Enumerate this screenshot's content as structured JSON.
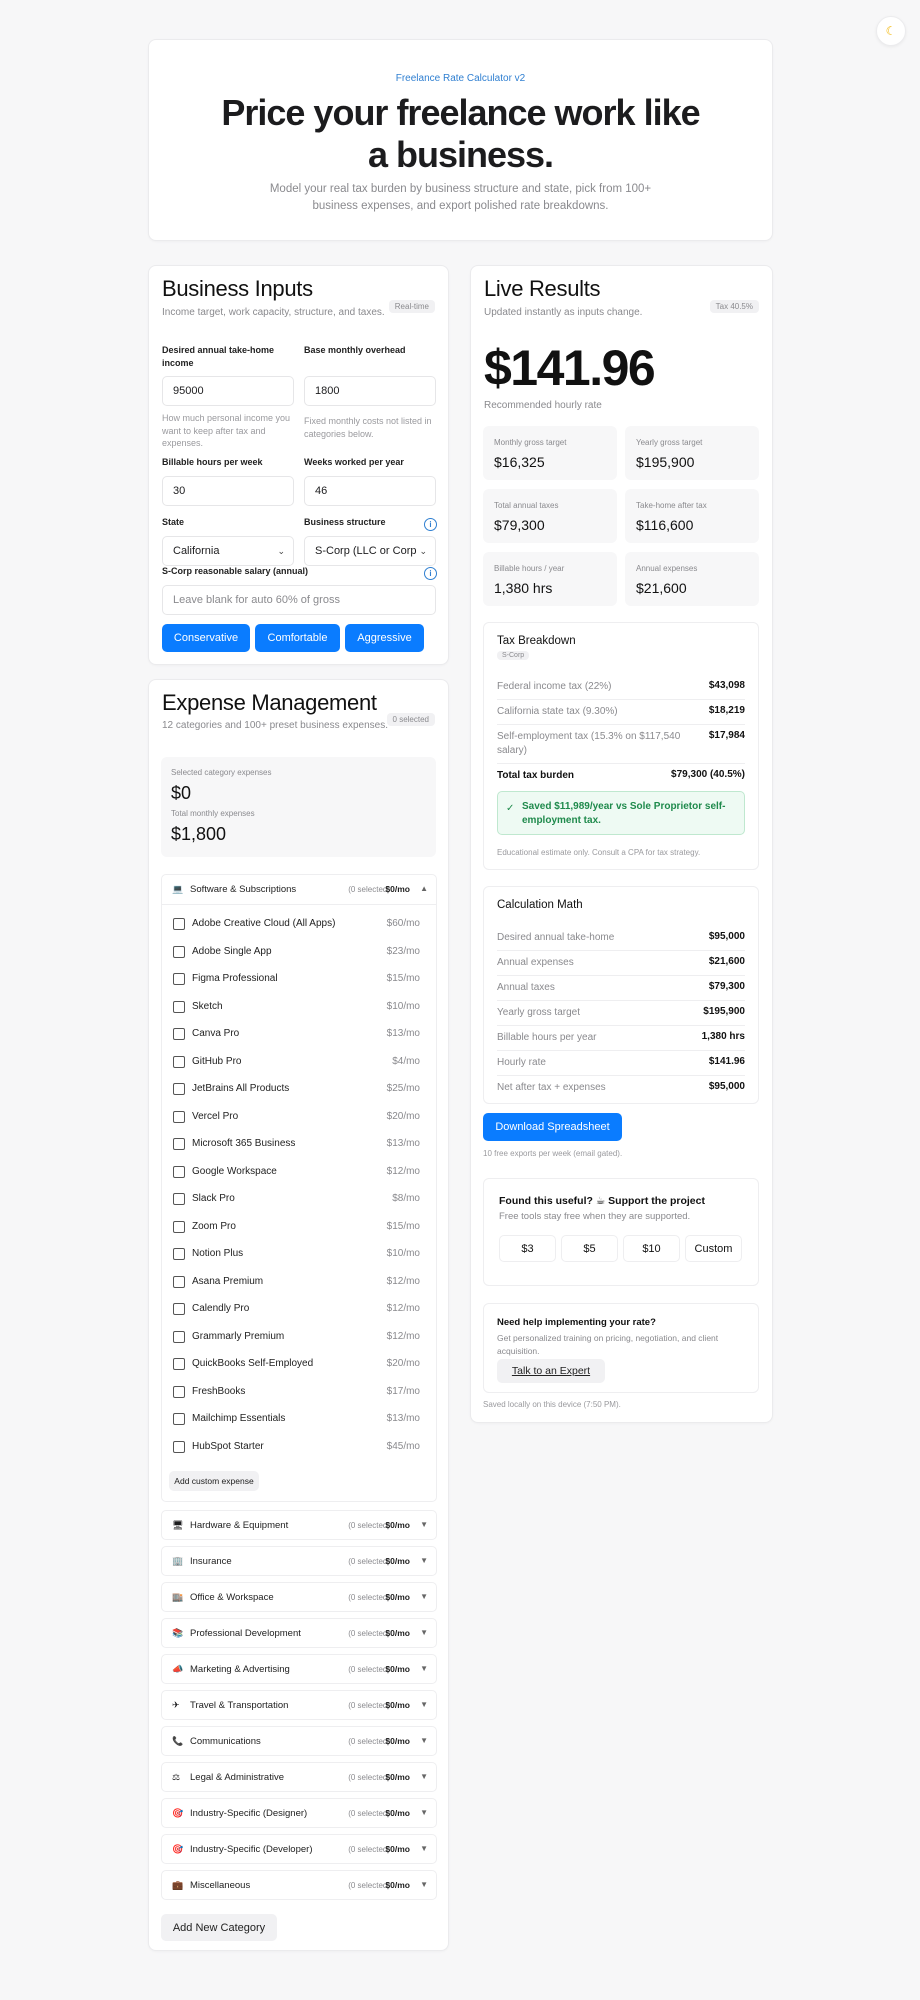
{
  "theme_icon": "moon-icon",
  "hero": {
    "eyebrow": "Freelance Rate Calculator v2",
    "title": "Price your freelance work like a business.",
    "subtitle": "Model your real tax burden by business structure and state, pick from 100+ business expenses, and export polished rate breakdowns."
  },
  "inputs": {
    "title": "Business Inputs",
    "subtitle": "Income target, work capacity, structure, and taxes.",
    "badge": "Real-time",
    "takehome": {
      "label": "Desired annual take-home income",
      "value": "95000",
      "hint": "How much personal income you want to keep after tax and expenses."
    },
    "overhead": {
      "label": "Base monthly overhead",
      "value": "1800",
      "hint": "Fixed monthly costs not listed in categories below."
    },
    "hours": {
      "label": "Billable hours per week",
      "value": "30"
    },
    "weeks": {
      "label": "Weeks worked per year",
      "value": "46"
    },
    "state": {
      "label": "State",
      "value": "California"
    },
    "structure": {
      "label": "Business structure",
      "value": "S-Corp (LLC or Corp"
    },
    "salary": {
      "label": "S-Corp reasonable salary (annual)",
      "placeholder": "Leave blank for auto 60% of gross"
    },
    "presets": [
      "Conservative",
      "Comfortable",
      "Aggressive"
    ]
  },
  "expenses": {
    "title": "Expense Management",
    "subtitle": "12 categories and 100+ preset business expenses.",
    "badge": "0 selected",
    "summary": {
      "selected_label": "Selected category expenses",
      "selected_value": "$0",
      "total_label": "Total monthly expenses",
      "total_value": "$1,800"
    },
    "open_category": {
      "icon": "laptop-icon",
      "name": "Software & Subscriptions",
      "selected": "(0 selected)",
      "amount": "$0/mo",
      "items": [
        {
          "name": "Adobe Creative Cloud (All Apps)",
          "price": "$60/mo"
        },
        {
          "name": "Adobe Single App",
          "price": "$23/mo"
        },
        {
          "name": "Figma Professional",
          "price": "$15/mo"
        },
        {
          "name": "Sketch",
          "price": "$10/mo"
        },
        {
          "name": "Canva Pro",
          "price": "$13/mo"
        },
        {
          "name": "GitHub Pro",
          "price": "$4/mo"
        },
        {
          "name": "JetBrains All Products",
          "price": "$25/mo"
        },
        {
          "name": "Vercel Pro",
          "price": "$20/mo"
        },
        {
          "name": "Microsoft 365 Business",
          "price": "$13/mo"
        },
        {
          "name": "Google Workspace",
          "price": "$12/mo"
        },
        {
          "name": "Slack Pro",
          "price": "$8/mo"
        },
        {
          "name": "Zoom Pro",
          "price": "$15/mo"
        },
        {
          "name": "Notion Plus",
          "price": "$10/mo"
        },
        {
          "name": "Asana Premium",
          "price": "$12/mo"
        },
        {
          "name": "Calendly Pro",
          "price": "$12/mo"
        },
        {
          "name": "Grammarly Premium",
          "price": "$12/mo"
        },
        {
          "name": "QuickBooks Self-Employed",
          "price": "$20/mo"
        },
        {
          "name": "FreshBooks",
          "price": "$17/mo"
        },
        {
          "name": "Mailchimp Essentials",
          "price": "$13/mo"
        },
        {
          "name": "HubSpot Starter",
          "price": "$45/mo"
        }
      ],
      "add_custom": "Add custom expense"
    },
    "categories": [
      {
        "icon": "desktop-icon",
        "glyph": "🖥",
        "name": "Hardware & Equipment",
        "selected": "(0 selected)",
        "amount": "$0/mo"
      },
      {
        "icon": "building-icon",
        "glyph": "🏢",
        "name": "Insurance",
        "selected": "(0 selected)",
        "amount": "$0/mo"
      },
      {
        "icon": "office-icon",
        "glyph": "🏬",
        "name": "Office & Workspace",
        "selected": "(0 selected)",
        "amount": "$0/mo"
      },
      {
        "icon": "books-icon",
        "glyph": "📚",
        "name": "Professional Development",
        "selected": "(0 selected)",
        "amount": "$0/mo"
      },
      {
        "icon": "megaphone-icon",
        "glyph": "📣",
        "name": "Marketing & Advertising",
        "selected": "(0 selected)",
        "amount": "$0/mo"
      },
      {
        "icon": "airplane-icon",
        "glyph": "✈",
        "name": "Travel & Transportation",
        "selected": "(0 selected)",
        "amount": "$0/mo"
      },
      {
        "icon": "phone-icon",
        "glyph": "📞",
        "name": "Communications",
        "selected": "(0 selected)",
        "amount": "$0/mo"
      },
      {
        "icon": "scale-icon",
        "glyph": "⚖",
        "name": "Legal & Administrative",
        "selected": "(0 selected)",
        "amount": "$0/mo"
      },
      {
        "icon": "target-icon",
        "glyph": "🎯",
        "name": "Industry-Specific (Designer)",
        "selected": "(0 selected)",
        "amount": "$0/mo"
      },
      {
        "icon": "target-icon",
        "glyph": "🎯",
        "name": "Industry-Specific (Developer)",
        "selected": "(0 selected)",
        "amount": "$0/mo"
      },
      {
        "icon": "briefcase-icon",
        "glyph": "💼",
        "name": "Miscellaneous",
        "selected": "(0 selected)",
        "amount": "$0/mo"
      }
    ],
    "add_category": "Add New Category"
  },
  "results": {
    "title": "Live Results",
    "subtitle": "Updated instantly as inputs change.",
    "badge": "Tax 40.5%",
    "rate": "$141.96",
    "rate_label": "Recommended hourly rate",
    "stats": [
      {
        "label": "Monthly gross target",
        "value": "$16,325"
      },
      {
        "label": "Yearly gross target",
        "value": "$195,900"
      },
      {
        "label": "Total annual taxes",
        "value": "$79,300"
      },
      {
        "label": "Take-home after tax",
        "value": "$116,600"
      },
      {
        "label": "Billable hours / year",
        "value": "1,380 hrs"
      },
      {
        "label": "Annual expenses",
        "value": "$21,600"
      }
    ],
    "tax": {
      "title": "Tax Breakdown",
      "tag": "S-Corp",
      "rows": [
        {
          "label": "Federal income tax (22%)",
          "value": "$43,098"
        },
        {
          "label": "California state tax (9.30%)",
          "value": "$18,219"
        },
        {
          "label": "Self-employment tax (15.3% on $117,540 salary)",
          "value": "$17,984"
        }
      ],
      "total_label": "Total tax burden",
      "total_value": "$79,300 (40.5%)",
      "saved": "Saved $11,989/year vs Sole Proprietor self-employment tax.",
      "note": "Educational estimate only. Consult a CPA for tax strategy."
    },
    "math": {
      "title": "Calculation Math",
      "rows": [
        {
          "label": "Desired annual take-home",
          "value": "$95,000"
        },
        {
          "label": "Annual expenses",
          "value": "$21,600"
        },
        {
          "label": "Annual taxes",
          "value": "$79,300"
        },
        {
          "label": "Yearly gross target",
          "value": "$195,900"
        },
        {
          "label": "Billable hours per year",
          "value": "1,380 hrs"
        },
        {
          "label": "Hourly rate",
          "value": "$141.96"
        },
        {
          "label": "Net after tax + expenses",
          "value": "$95,000"
        }
      ]
    },
    "download": "Download Spreadsheet",
    "download_note": "10 free exports per week (email gated).",
    "support": {
      "title": "Found this useful? ☕ Support the project",
      "subtitle": "Free tools stay free when they are supported.",
      "amounts": [
        "$3",
        "$5",
        "$10",
        "Custom"
      ]
    },
    "help": {
      "title": "Need help implementing your rate?",
      "subtitle": "Get personalized training on pricing, negotiation, and client acquisition.",
      "button": "Talk to an Expert"
    },
    "saved_note": "Saved locally on this device (7:50 PM)."
  }
}
